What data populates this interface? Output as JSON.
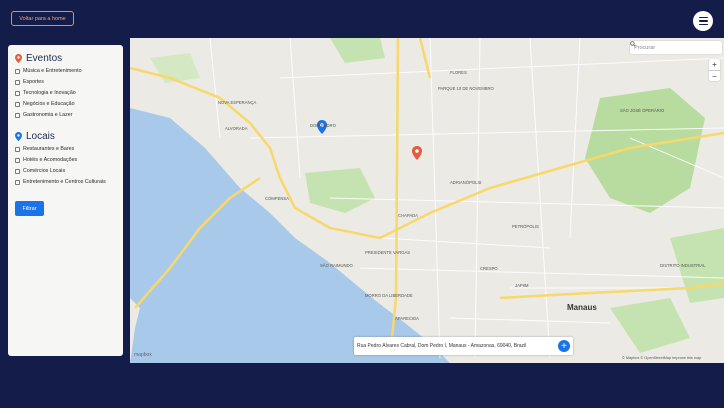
{
  "header": {
    "back_label": "Voltar para a home"
  },
  "sidebar": {
    "events_title": "Eventos",
    "events": [
      "Música e Entretenimento",
      "Esportes",
      "Tecnologia e Inovação",
      "Negócios e Educação",
      "Gastronomia e Lazer"
    ],
    "places_title": "Locais",
    "places": [
      "Restaurantes e Bares",
      "Hotéis e Acomodações",
      "Comércios Locais",
      "Entretenimento e Centros Culturais"
    ],
    "filter_label": "Filtrar"
  },
  "map": {
    "search_placeholder": "Procurar",
    "zoom_in": "+",
    "zoom_out": "−",
    "address": "Rua Pedro Álvares Cabral, Dom Pedro I, Manaus - Amazonas, 69040, Brazil",
    "add_label": "+",
    "attribution": "© Mapbox © OpenStreetMap Improve this map",
    "logo": "mapbox",
    "city": "Manaus",
    "labels": [
      "NOVA ESPERANÇA",
      "DOM PEDRO",
      "PARQUE 10 DE NOVEMBRO",
      "ADRIANÓPOLIS",
      "COMPENSA",
      "SÃO RAIMUNDO",
      "PRESIDENTE VARGAS",
      "PETRÓPOLIS",
      "SÃO JOSÉ OPERÁRIO",
      "DISTRITO INDUSTRIAL",
      "ALVORADA",
      "FLORES",
      "CHAPADA",
      "APARECIDA",
      "JAPIIM",
      "CRESPO",
      "MORRO DA LIBERDADE"
    ],
    "colors": {
      "water": "#a9c9ea",
      "park": "#b8dca0",
      "road_major": "#f6d86b",
      "road": "#ffffff",
      "pin_event": "#e55d3e",
      "pin_place": "#1a73e8"
    }
  }
}
